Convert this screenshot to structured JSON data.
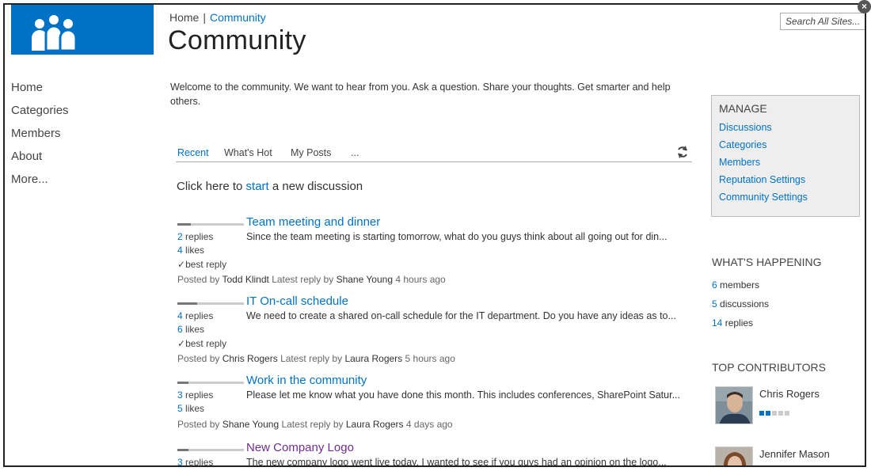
{
  "breadcrumb": {
    "home": "Home",
    "separator": "|",
    "current": "Community"
  },
  "page_title": "Community",
  "search": {
    "placeholder": "Search All Sites..."
  },
  "left_nav": [
    "Home",
    "Categories",
    "Members",
    "About",
    "More..."
  ],
  "welcome": "Welcome to the community. We want to hear from you. Ask a question. Share your thoughts. Get smarter and help others.",
  "tabs": {
    "recent": "Recent",
    "hot": "What's Hot",
    "mine": "My Posts",
    "more": "..."
  },
  "start": {
    "before": "Click here to ",
    "link": "start",
    "after": " a new discussion"
  },
  "posts": [
    {
      "title": "Team meeting and dinner",
      "excerpt": "Since the team meeting is starting tomorrow, what do you guys think about all going out for din...",
      "replies_num": "2",
      "replies_label": " replies",
      "likes_num": "4",
      "likes_label": " likes",
      "best_reply": "best reply",
      "posted_by_label": "Posted by ",
      "author": "Todd Klindt",
      "latest_label": "  Latest reply by ",
      "latest_author": "Shane Young",
      "time": " 4 hours ago",
      "activity": 0.2
    },
    {
      "title": "IT On-call schedule",
      "excerpt": "We need to create a shared on-call schedule for the IT department. Do you have any ideas as to...",
      "replies_num": "4",
      "replies_label": " replies",
      "likes_num": "6",
      "likes_label": " likes",
      "best_reply": "best reply",
      "posted_by_label": "Posted by ",
      "author": "Chris Rogers",
      "latest_label": "  Latest reply by ",
      "latest_author": "Laura Rogers",
      "time": " 5 hours ago",
      "activity": 0.3
    },
    {
      "title": "Work in the community",
      "excerpt": "Please let me know what you have done this month. This includes conferences, SharePoint Satur...",
      "replies_num": "3",
      "replies_label": " replies",
      "likes_num": "5",
      "likes_label": " likes",
      "posted_by_label": "Posted by ",
      "author": "Shane Young",
      "latest_label": "  Latest reply by ",
      "latest_author": "Laura Rogers",
      "time": " 4 days ago",
      "activity": 0.17
    },
    {
      "title": "New Company Logo",
      "excerpt": "The new company logo went live today. I wanted to see if you guys had an opinion on the logo...",
      "replies_num": "3",
      "replies_label": " replies",
      "activity": 0.17
    }
  ],
  "manage": {
    "heading": "MANAGE",
    "links": [
      "Discussions",
      "Categories",
      "Members",
      "Reputation Settings",
      "Community Settings"
    ]
  },
  "whats_happening": {
    "heading": "WHAT'S HAPPENING",
    "members_num": "6",
    "members_label": " members",
    "discussions_num": "5",
    "discussions_label": " discussions",
    "replies_num": "14",
    "replies_label": " replies"
  },
  "top_contributors": {
    "heading": "TOP CONTRIBUTORS",
    "people": [
      {
        "name": "Chris Rogers",
        "reputation_level": 2,
        "reputation_max": 5
      },
      {
        "name": "Jennifer Mason"
      }
    ]
  },
  "colors": {
    "accent": "#0072c6",
    "visited": "#6f2d8f",
    "panel": "#eeeeee"
  }
}
